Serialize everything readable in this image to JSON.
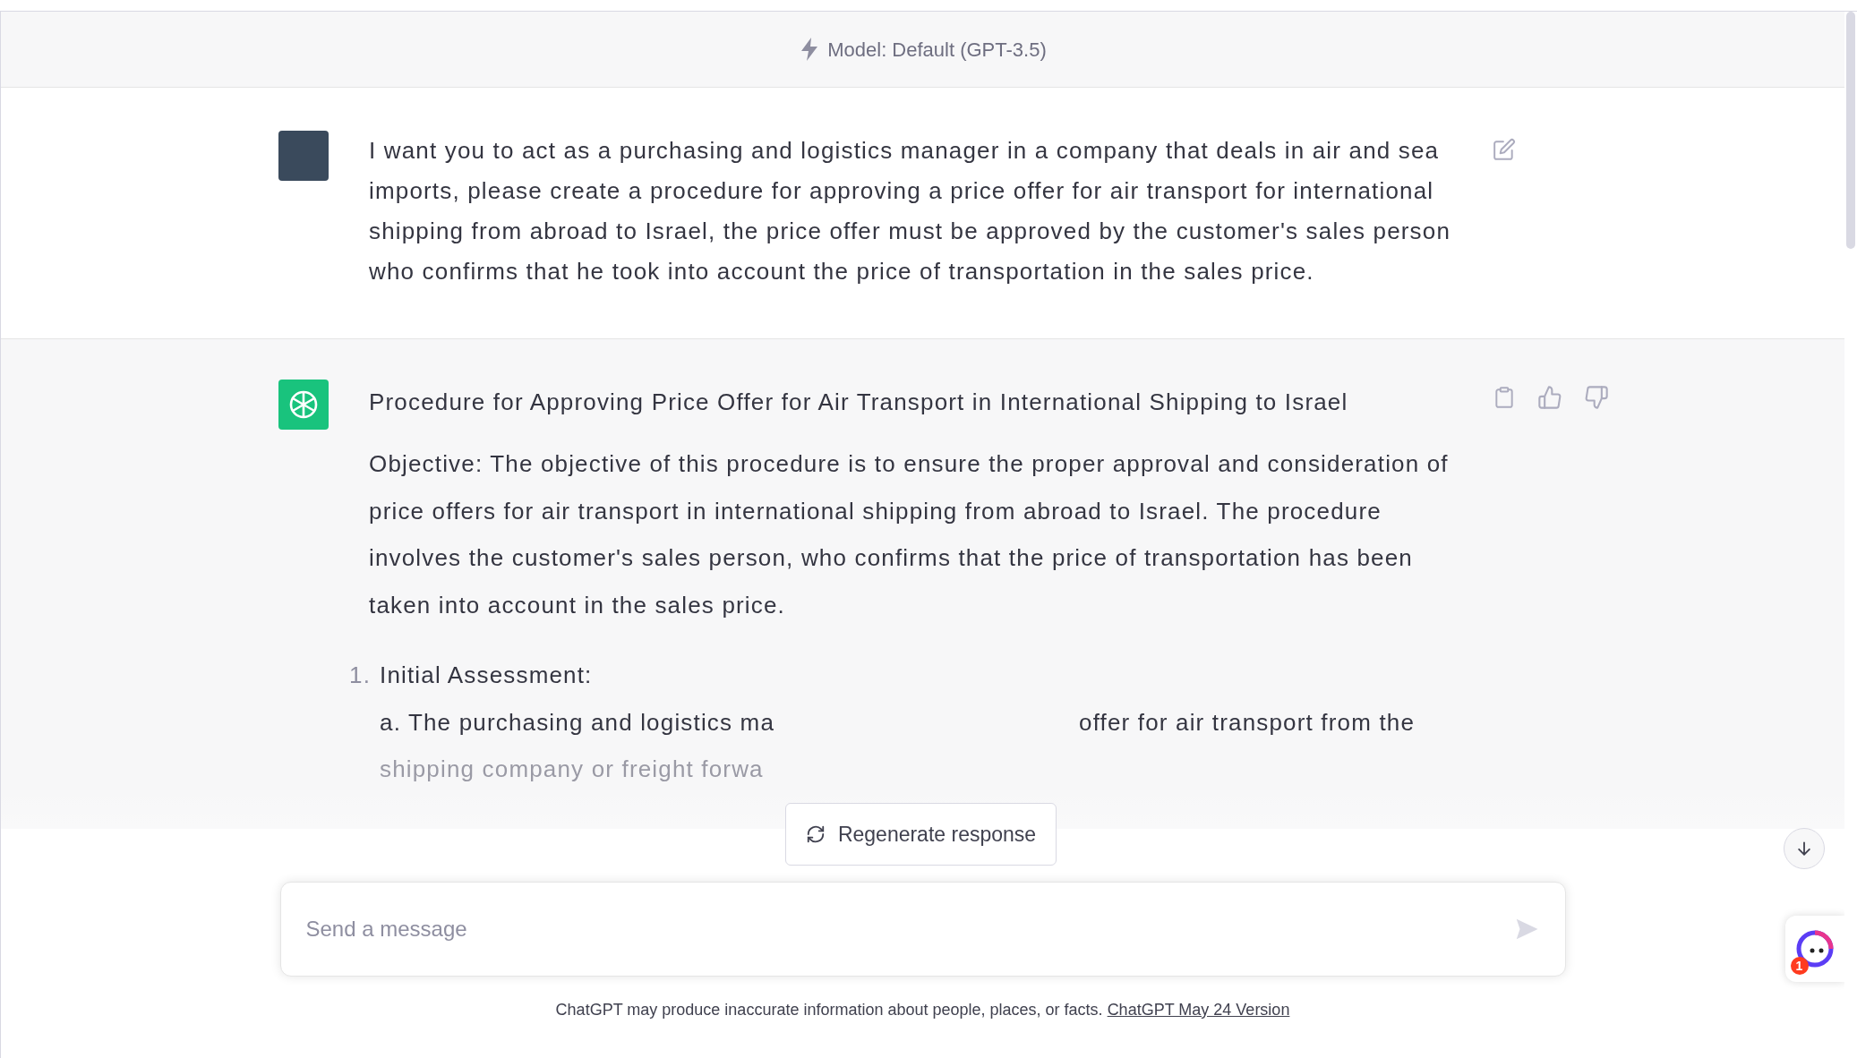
{
  "header": {
    "model_label": "Model: Default (GPT-3.5)"
  },
  "messages": [
    {
      "kind": "user",
      "paragraphs": [
        "I want you to act as a purchasing and logistics manager in a company that deals in air and sea imports, please create a procedure for approving a price offer for air transport for international shipping from abroad to Israel, the price offer must be approved by the customer's sales person who confirms that he took into account the price of transportation in the sales price."
      ]
    },
    {
      "kind": "assistant",
      "title": "Procedure for Approving Price Offer for Air Transport in International Shipping to Israel",
      "paragraphs": [
        "Objective: The objective of this procedure is to ensure the proper approval and consideration of price offers for air transport in international shipping from abroad to Israel. The procedure involves the customer's sales person, who confirms that the price of transportation has been taken into account in the sales price."
      ],
      "list": [
        {
          "number": "1.",
          "heading": "Initial Assessment:",
          "line_1_start": "a. The purchasing and logistics ma",
          "line_1_end": "offer for air transport from the",
          "line_2_start": "shipping company or freight forwa"
        }
      ]
    }
  ],
  "regenerate_button": "Regenerate response",
  "composer": {
    "placeholder": "Send a message"
  },
  "footer": {
    "text": "ChatGPT may produce inaccurate information about people, places, or facts.",
    "link": "ChatGPT May 24 Version"
  },
  "widget": {
    "badge": "1"
  }
}
